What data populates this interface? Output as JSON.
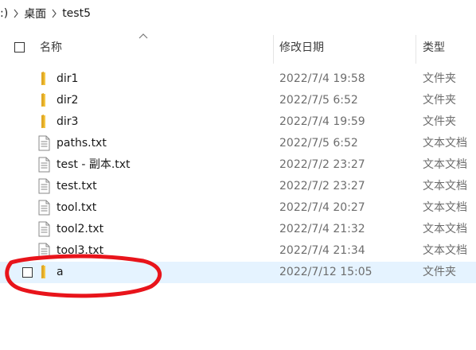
{
  "breadcrumb": {
    "drive": ":)",
    "items": [
      "桌面",
      "test5"
    ]
  },
  "header": {
    "name": "名称",
    "date": "修改日期",
    "type": "类型",
    "sort": "ascending by name"
  },
  "files": [
    {
      "name": "dir1",
      "date": "2022/7/4 19:58",
      "type": "文件夹",
      "kind": "folder"
    },
    {
      "name": "dir2",
      "date": "2022/7/5 6:52",
      "type": "文件夹",
      "kind": "folder"
    },
    {
      "name": "dir3",
      "date": "2022/7/4 19:59",
      "type": "文件夹",
      "kind": "folder"
    },
    {
      "name": "paths.txt",
      "date": "2022/7/5 6:52",
      "type": "文本文档",
      "kind": "text"
    },
    {
      "name": "test - 副本.txt",
      "date": "2022/7/2 23:27",
      "type": "文本文档",
      "kind": "text"
    },
    {
      "name": "test.txt",
      "date": "2022/7/2 23:27",
      "type": "文本文档",
      "kind": "text"
    },
    {
      "name": "tool.txt",
      "date": "2022/7/4 20:27",
      "type": "文本文档",
      "kind": "text"
    },
    {
      "name": "tool2.txt",
      "date": "2022/7/4 21:32",
      "type": "文本文档",
      "kind": "text"
    },
    {
      "name": "tool3.txt",
      "date": "2022/7/4 21:34",
      "type": "文本文档",
      "kind": "text"
    },
    {
      "name": "a",
      "date": "2022/7/12 15:05",
      "type": "文件夹",
      "kind": "folder",
      "selected": true
    }
  ],
  "colors": {
    "selected_row": "#e5f3ff",
    "annotation": "#e8141b",
    "folder": "#f5c642"
  }
}
